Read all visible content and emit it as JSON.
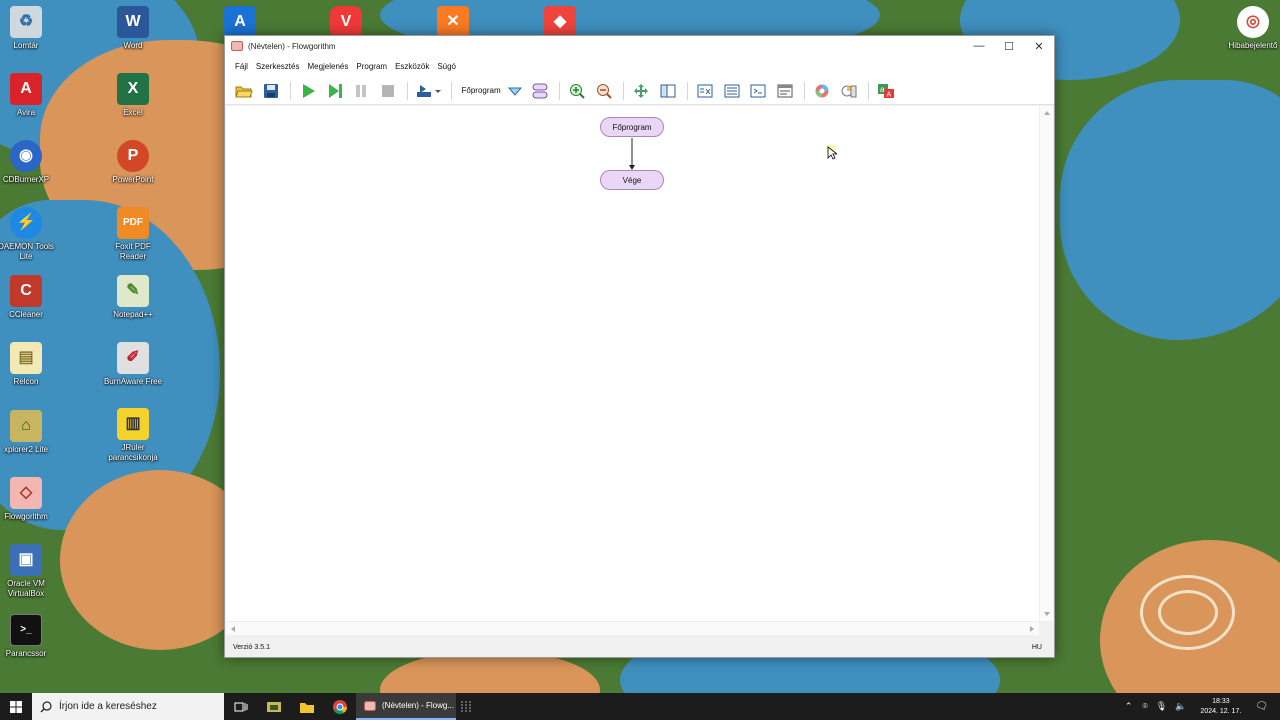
{
  "window": {
    "title": "(Névtelen) - Flowgorithm",
    "minimize_symbol": "—",
    "maximize_symbol": "☐",
    "close_symbol": "✕"
  },
  "menu": [
    "Fájl",
    "Szerkesztés",
    "Megjelenés",
    "Program",
    "Eszközök",
    "Súgó"
  ],
  "toolbar": {
    "function_select": "Főprogram",
    "icons": [
      "open-icon",
      "save-icon",
      "run-icon",
      "step-icon",
      "pause-icon",
      "stop-icon",
      "run-speed-icon",
      "function-dropdown-icon",
      "layout-icon",
      "zoom-in-icon",
      "zoom-out-icon",
      "move-icon",
      "split-view-icon",
      "variable-watch-icon",
      "source-code-icon",
      "console-icon",
      "console-window-icon",
      "color-icon",
      "chart-style-icon",
      "language-icon"
    ]
  },
  "flowchart": {
    "start_label": "Főprogram",
    "end_label": "Vége"
  },
  "status": {
    "version": "Verzió 3.5.1",
    "locale": "HU"
  },
  "desktop": {
    "icons_left": [
      "Lomtár",
      "Avira",
      "CDBurnerXP",
      "DAEMON Tools Lite",
      "CCleaner",
      "Relcon",
      "xplorer2 Lite",
      "Flowgorithm",
      "Oracle VM VirtualBox",
      "Parancssor"
    ],
    "icons_second": [
      "Word",
      "Excel",
      "PowerPoint",
      "Foxit PDF Reader",
      "Notepad++",
      "BurnAware Free",
      "JRuler parancsikonja"
    ],
    "icons_right": [
      "Hibabejelentő"
    ]
  },
  "taskbar": {
    "search_placeholder": "Írjon ide a kereséshez",
    "active_task": "(Névtelen) - Flowg...",
    "time": "18:33",
    "date": "2024. 12. 17."
  },
  "colors": {
    "node_fill": "#ead6f7",
    "node_border": "#a48bb8",
    "taskbar": "#1c1c1c"
  }
}
